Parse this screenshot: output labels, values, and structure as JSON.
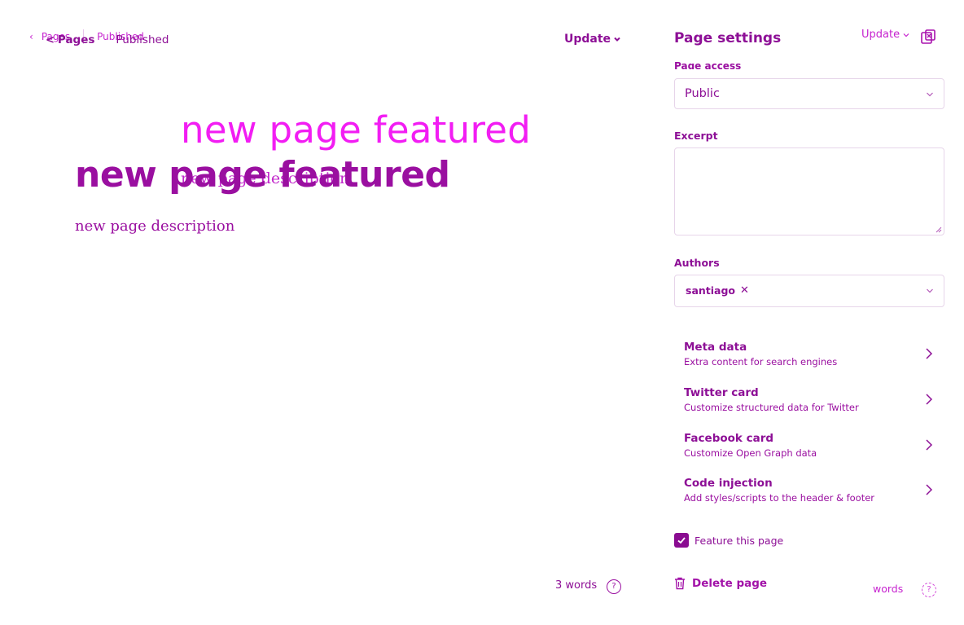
{
  "editor": {
    "breadcrumb_ghost": {
      "back_label": "Pages",
      "status": "Published"
    },
    "breadcrumb": {
      "back_label": "Pages",
      "status": "Published"
    },
    "update_label": "Update",
    "title_ghost": "new page featured",
    "title": "new page featured",
    "description_ghost": "new page description",
    "description": "new page description",
    "word_count": "3 words",
    "help_glyph": "?"
  },
  "settings": {
    "panel_title": "Page settings",
    "update_label": "Update",
    "page_access": {
      "label": "Page access",
      "value": "Public"
    },
    "excerpt": {
      "label": "Excerpt",
      "value": ""
    },
    "authors": {
      "label": "Authors",
      "tokens": [
        "santiago"
      ],
      "remove_glyph": "✕"
    },
    "menu": [
      {
        "title": "Meta data",
        "subtitle": "Extra content for search engines"
      },
      {
        "title": "Twitter card",
        "subtitle": "Customize structured data for Twitter"
      },
      {
        "title": "Facebook card",
        "subtitle": "Customize Open Graph data"
      },
      {
        "title": "Code injection",
        "subtitle": "Add styles/scripts to the header & footer"
      }
    ],
    "feature": {
      "label": "Feature this page",
      "checked": true
    },
    "delete_label": "Delete page",
    "words_ghost": "words",
    "help_glyph": "?"
  },
  "icons": [
    "chevron-left-icon",
    "chevron-down-icon",
    "chevron-right-icon",
    "close-panel-icon",
    "trash-icon",
    "check-icon",
    "help-icon"
  ],
  "colors": {
    "accent": "#8d0f96",
    "ghost_accent": "#e01ce8",
    "checkbox": "#8a0c91",
    "border": "#e7d5ea"
  }
}
